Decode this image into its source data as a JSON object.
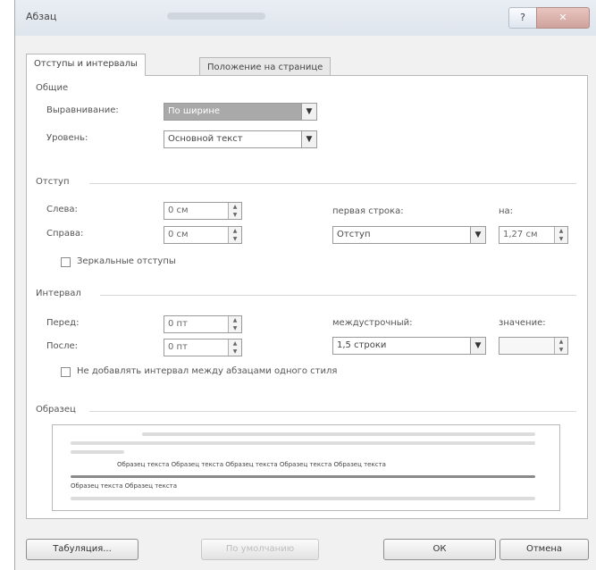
{
  "window": {
    "title": "Абзац",
    "help_glyph": "?",
    "close_glyph": "✕"
  },
  "tabs": [
    {
      "label": "Отступы и интервалы",
      "active": true
    },
    {
      "label": "Положение на странице",
      "active": false
    }
  ],
  "general": {
    "heading": "Общие",
    "alignment_label": "Выравнивание:",
    "alignment_value": "По ширине",
    "level_label": "Уровень:",
    "level_value": "Основной текст"
  },
  "indent": {
    "heading": "Отступ",
    "left_label": "Слева:",
    "left_value": "0 см",
    "right_label": "Справа:",
    "right_value": "0 см",
    "first_line_label": "первая строка:",
    "first_line_value": "Отступ",
    "by_label": "на:",
    "by_value": "1,27 см",
    "mirror_label": "Зеркальные отступы"
  },
  "spacing": {
    "heading": "Интервал",
    "before_label": "Перед:",
    "before_value": "0 пт",
    "after_label": "После:",
    "after_value": "0 пт",
    "line_spacing_label": "междустрочный:",
    "line_spacing_value": "1,5 строки",
    "at_label": "значение:",
    "at_value": "",
    "no_space_label": "Не добавлять интервал между абзацами одного стиля"
  },
  "preview": {
    "heading": "Образец",
    "sample_text": "Образец текста Образец текста Образец текста Образец текста Образец текста",
    "last_line": "Образец текста Образец текста"
  },
  "buttons": {
    "tabs": "Табуляция...",
    "default": "По умолчанию",
    "ok": "ОК",
    "cancel": "Отмена"
  },
  "colors": {
    "selection": "#a9a9a9",
    "panel_bg": "#ffffff",
    "dialog_bg": "#f1f1f1"
  }
}
